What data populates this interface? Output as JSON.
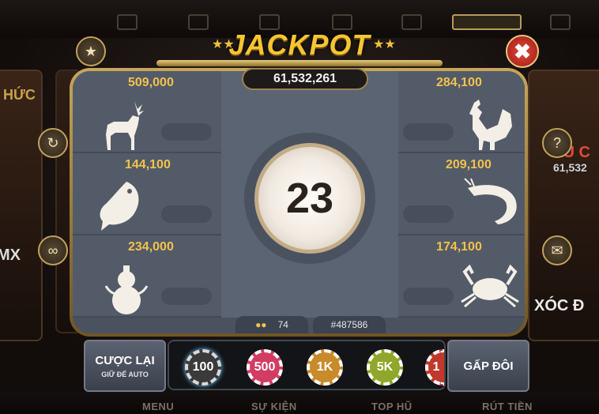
{
  "jackpot": {
    "title": "JACKPOT",
    "amount": "61,532,261"
  },
  "cells": [
    {
      "animal": "deer",
      "amount": "509,000"
    },
    {
      "animal": "rooster",
      "amount": "284,100"
    },
    {
      "animal": "fish",
      "amount": "144,100"
    },
    {
      "animal": "shrimp",
      "amount": "209,100"
    },
    {
      "animal": "gourd",
      "amount": "234,000"
    },
    {
      "animal": "crab",
      "amount": "174,100"
    }
  ],
  "countdown": "23",
  "players": "74",
  "session": "#487586",
  "rebet": {
    "label": "CƯỢC LẠI",
    "sublabel": "GIỮ ĐỂ AUTO"
  },
  "double": {
    "label": "GẤP ĐÔI"
  },
  "chips": [
    {
      "label": "100",
      "color": "#3a3a3a"
    },
    {
      "label": "500",
      "color": "#d23c63"
    },
    {
      "label": "1K",
      "color": "#c98a2a"
    },
    {
      "label": "5K",
      "color": "#8fa72a"
    },
    {
      "label": "1",
      "color": "#c0392b"
    }
  ],
  "bottom_nav": [
    "MENU",
    "SỰ KIỆN",
    "TOP HŨ",
    "RÚT TIỀN"
  ],
  "side": {
    "left_top": "HỨC",
    "left_mid": "MX",
    "right_top": "ẦU C",
    "right_amount": "61,532",
    "right_bottom": "XÓC Đ"
  },
  "colors": {
    "gold": "#f2c24a",
    "panel": "#4a525f",
    "close": "#d23a2c"
  }
}
